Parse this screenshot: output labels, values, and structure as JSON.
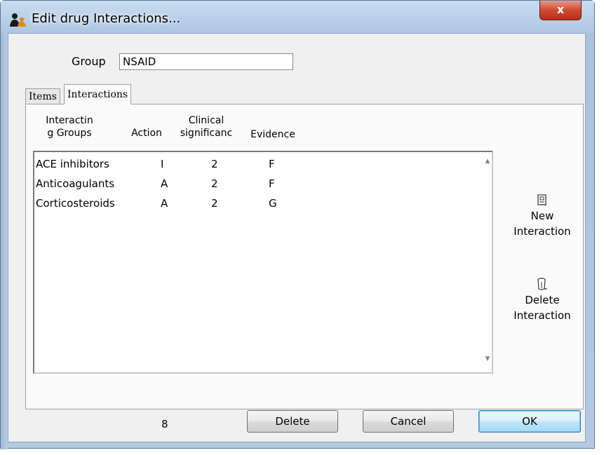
{
  "window": {
    "title": "Edit drug Interactions...",
    "close_label": "x",
    "accent": "#c7d9ee",
    "close_color": "#c94a2d"
  },
  "group": {
    "label": "Group",
    "value": "NSAID"
  },
  "tabs": [
    {
      "label": "Items",
      "active": false
    },
    {
      "label": "Interactions",
      "active": true
    }
  ],
  "table": {
    "headers": {
      "group": [
        "Interactin",
        "g Groups"
      ],
      "action": "Action",
      "significance": [
        "Clinical",
        "significanc"
      ],
      "evidence": "Evidence"
    },
    "rows": [
      {
        "group": "ACE inhibitors",
        "action": "I",
        "significance": "2",
        "evidence": "F"
      },
      {
        "group": "Anticoagulants",
        "action": "A",
        "significance": "2",
        "evidence": "F"
      },
      {
        "group": "Corticosteroids",
        "action": "A",
        "significance": "2",
        "evidence": "G"
      }
    ]
  },
  "side": {
    "new_line1": "New",
    "new_line2": "Interaction",
    "delete_line1": "Delete",
    "delete_line2": "Interaction"
  },
  "footer": {
    "count": "8",
    "delete_label": "Delete",
    "cancel_label": "Cancel",
    "ok_label": "OK"
  }
}
